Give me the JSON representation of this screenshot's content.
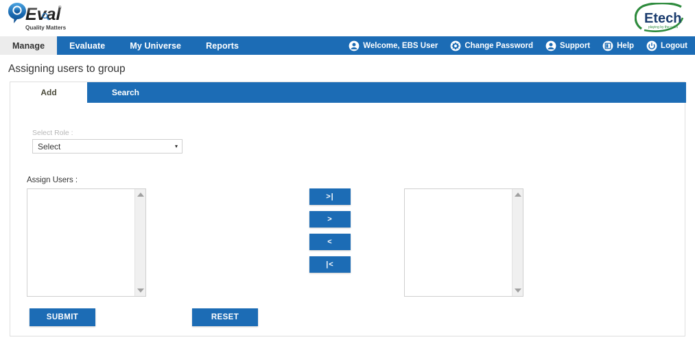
{
  "header": {
    "product_logo": {
      "name": "qeval-logo",
      "mark_letter": "Q",
      "wordmark": "Eval",
      "trademark": "®",
      "tagline": "Quality Matters"
    },
    "company_logo": {
      "name": "etech-logo",
      "wordmark": "Etech",
      "tagline": "playing by the rules"
    }
  },
  "navbar": {
    "tabs": [
      {
        "label": "Manage",
        "active": true
      },
      {
        "label": "Evaluate",
        "active": false
      },
      {
        "label": "My Universe",
        "active": false
      },
      {
        "label": "Reports",
        "active": false
      }
    ],
    "items": [
      {
        "label": "Welcome, EBS User",
        "icon": "user-icon"
      },
      {
        "label": "Change Password",
        "icon": "gear-icon"
      },
      {
        "label": "Support",
        "icon": "user-icon"
      },
      {
        "label": "Help",
        "icon": "book-icon"
      },
      {
        "label": "Logout",
        "icon": "power-icon"
      }
    ]
  },
  "page": {
    "title": "Assigning users to group"
  },
  "card": {
    "tabs": [
      {
        "label": "Add",
        "active": true
      },
      {
        "label": "Search",
        "active": false
      }
    ],
    "role_field": {
      "label": "Select Role :",
      "value": "Select",
      "placeholder": "Select",
      "arrow": "▾"
    },
    "assign_users": {
      "label": "Assign Users :",
      "available_items": [],
      "assigned_items": []
    },
    "transfer_buttons": [
      {
        "label": ">|",
        "name": "move-all-right-button"
      },
      {
        "label": ">",
        "name": "move-right-button"
      },
      {
        "label": "<",
        "name": "move-left-button"
      },
      {
        "label": "|<",
        "name": "move-all-left-button"
      }
    ],
    "actions": {
      "submit_label": "SUBMIT",
      "reset_label": "RESET"
    }
  },
  "colors": {
    "brand_blue": "#1c6cb5",
    "active_tab_bg": "#ececec",
    "border_gray": "#cfcfcf",
    "label_gray": "#b6b6b6",
    "etech_green": "#2e8b3d",
    "etech_navy": "#1b3c6e"
  }
}
